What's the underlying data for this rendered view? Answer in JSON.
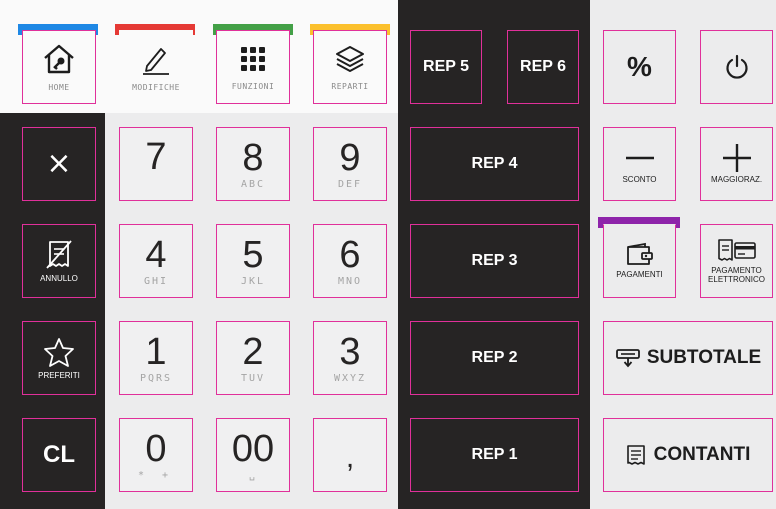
{
  "colors": {
    "accent": "#e0309a",
    "dark_panel": "#262424",
    "home_bar": "#1e88e5",
    "modifiche_bar": "#e53935",
    "funzioni_bar": "#43a047",
    "reparti_bar": "#fbc02d",
    "pagamenti_bar": "#8e24aa"
  },
  "top_menu": [
    {
      "label": "HOME",
      "icon": "home-key-icon"
    },
    {
      "label": "MODIFICHE",
      "icon": "pencil-icon"
    },
    {
      "label": "FUNZIONI",
      "icon": "grid-icon"
    },
    {
      "label": "REPARTI",
      "icon": "layers-icon"
    }
  ],
  "left_actions": {
    "cancel_icon": "×",
    "annullo": "ANNULLO",
    "preferiti": "PREFERITI",
    "clear": "CL"
  },
  "keypad": {
    "k7": {
      "digit": "7",
      "sub": ""
    },
    "k8": {
      "digit": "8",
      "sub": "ABC"
    },
    "k9": {
      "digit": "9",
      "sub": "DEF"
    },
    "k4": {
      "digit": "4",
      "sub": "GHI"
    },
    "k5": {
      "digit": "5",
      "sub": "JKL"
    },
    "k6": {
      "digit": "6",
      "sub": "MNO"
    },
    "k1": {
      "digit": "1",
      "sub": "PQRS"
    },
    "k2": {
      "digit": "2",
      "sub": "TUV"
    },
    "k3": {
      "digit": "3",
      "sub": "WXYZ"
    },
    "k0": {
      "digit": "0",
      "sub": "* +"
    },
    "k00": {
      "digit": "00",
      "sub": "␣"
    },
    "comma": {
      "digit": ",",
      "sub": ""
    }
  },
  "reparti": {
    "rep5": "REP 5",
    "rep6": "REP 6",
    "rep4": "REP 4",
    "rep3": "REP 3",
    "rep2": "REP 2",
    "rep1": "REP 1"
  },
  "right_panel": {
    "percent": "%",
    "power_icon": "power-icon",
    "sconto": "SCONTO",
    "maggioraz": "MAGGIORAZ.",
    "pagamenti": "PAGAMENTI",
    "pagamento_elettronico_1": "PAGAMENTO",
    "pagamento_elettronico_2": "ELETTRONICO",
    "subtotale": "SUBTOTALE",
    "contanti": "CONTANTI"
  }
}
